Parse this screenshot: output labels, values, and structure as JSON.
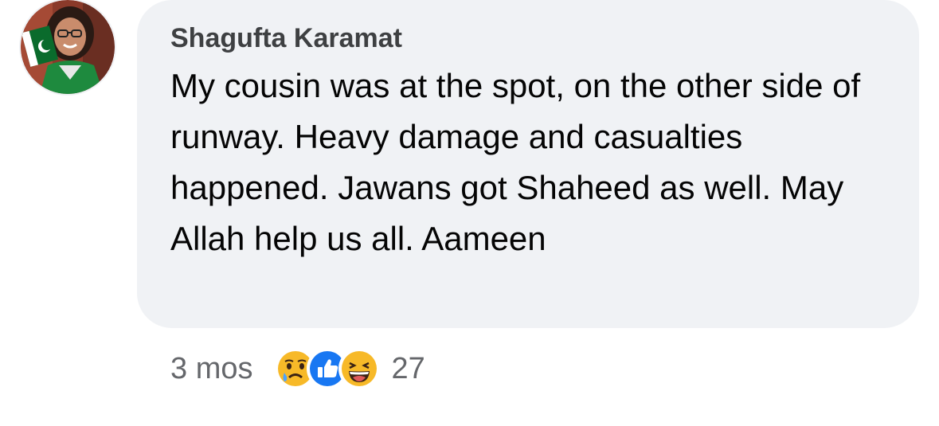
{
  "comment": {
    "author": "Shagufta Karamat",
    "text": "My cousin was at the spot, on the other side of runway. Heavy damage and casualties happened. Jawans got Shaheed as well. May Allah help us all. Aameen",
    "timestamp": "3 mos",
    "reaction_count": "27",
    "reactions": [
      "sad-emoji-icon",
      "like-icon",
      "haha-emoji-icon"
    ]
  },
  "colors": {
    "bubble_bg": "#f0f2f5",
    "author_text": "#3e4042",
    "body_text": "#050505",
    "meta_text": "#65676b",
    "like_blue": "#1877f2",
    "emoji_yellow": "#f7b928"
  }
}
